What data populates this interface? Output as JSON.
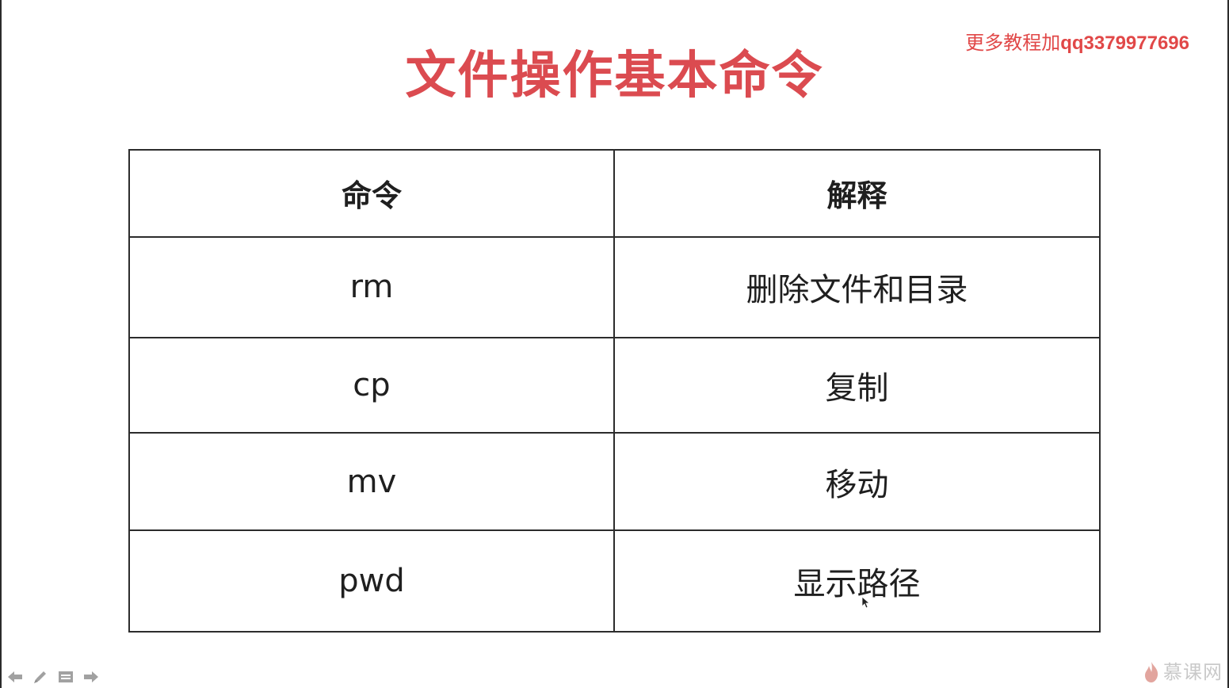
{
  "watermark": {
    "prefix": "更多教程加",
    "qq": "qq3379977696"
  },
  "title": "文件操作基本命令",
  "table": {
    "headers": [
      "命令",
      "解释"
    ],
    "rows": [
      {
        "command": "rm",
        "description": "删除文件和目录"
      },
      {
        "command": "cp",
        "description": "复制"
      },
      {
        "command": "mv",
        "description": "移动"
      },
      {
        "command": "pwd",
        "description": "显示路径"
      }
    ]
  },
  "toolbar": {
    "icons": [
      "arrow-left-icon",
      "pen-icon",
      "slides-menu-icon",
      "arrow-right-icon"
    ]
  },
  "logo": {
    "text": "慕课网"
  },
  "colors": {
    "title": "#db4b50",
    "watermark": "#e14848",
    "border": "#2c2c2c",
    "text": "#1f1f1f"
  }
}
